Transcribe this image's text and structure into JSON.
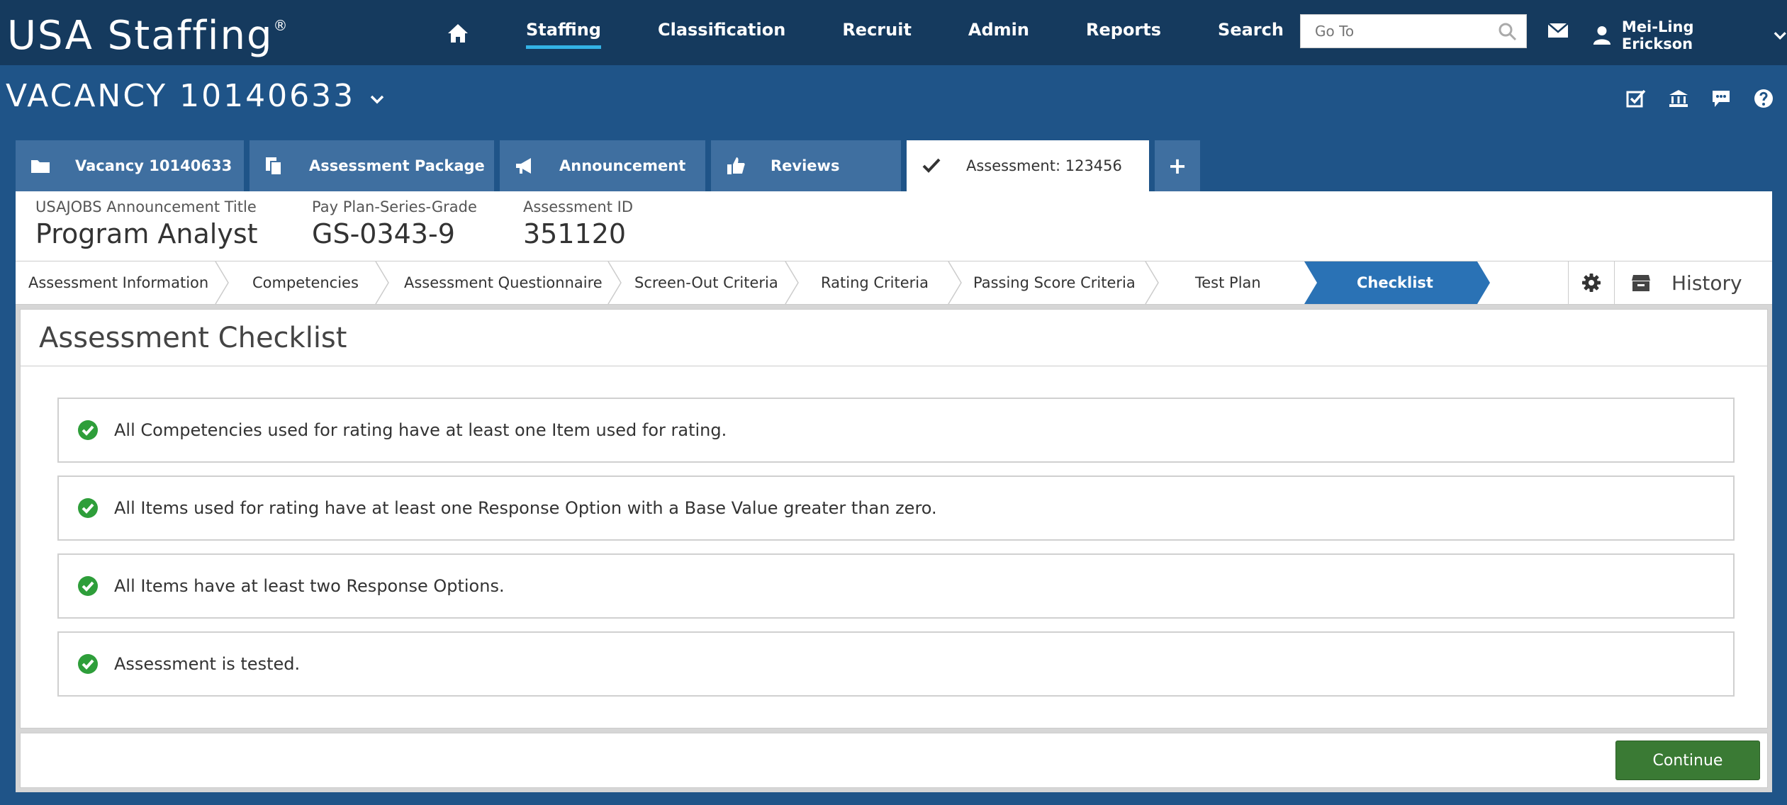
{
  "app": {
    "logo_text": "USA Staffing",
    "logo_mark": "®"
  },
  "nav": {
    "links": [
      "Staffing",
      "Classification",
      "Recruit",
      "Admin",
      "Reports",
      "Search"
    ],
    "active": "Staffing",
    "goto_placeholder": "Go To",
    "user_name": "Mei-Ling Erickson"
  },
  "vacancy": {
    "title": "VACANCY 10140633"
  },
  "tabs": [
    {
      "label": "Vacancy 10140633",
      "icon": "folder-icon"
    },
    {
      "label": "Assessment Package",
      "icon": "documents-icon"
    },
    {
      "label": "Announcement",
      "icon": "megaphone-icon"
    },
    {
      "label": "Reviews",
      "icon": "thumbs-up-icon"
    },
    {
      "label": "Assessment: 123456",
      "icon": "checkmark-icon",
      "active": true
    },
    {
      "label": "+",
      "icon": "plus-icon"
    }
  ],
  "info": {
    "title_label": "USAJOBS Announcement Title",
    "title_value": "Program Analyst",
    "grade_label": "Pay Plan-Series-Grade",
    "grade_value": "GS-0343-9",
    "id_label": "Assessment ID",
    "id_value": "351120"
  },
  "steps": [
    "Assessment Information",
    "Competencies",
    "Assessment Questionnaire",
    "Screen-Out Criteria",
    "Rating Criteria",
    "Passing Score Criteria",
    "Test Plan",
    "Checklist"
  ],
  "active_step": "Checklist",
  "history_label": "History",
  "checklist": {
    "title": "Assessment Checklist",
    "items": [
      "All Competencies used for rating have at least one Item used for rating.",
      "All Items used for rating have at least one Response Option with a Base Value greater than zero.",
      "All Items have at least two Response Options.",
      "Assessment is tested."
    ]
  },
  "footer": {
    "continue_label": "Continue"
  },
  "colors": {
    "nav_bg": "#153a5e",
    "page_bg": "#1f5488",
    "tab_bg": "#3f6fa0",
    "active_step": "#2a72b5",
    "success_green": "#2e9e3a",
    "continue_green": "#3a7a34"
  }
}
